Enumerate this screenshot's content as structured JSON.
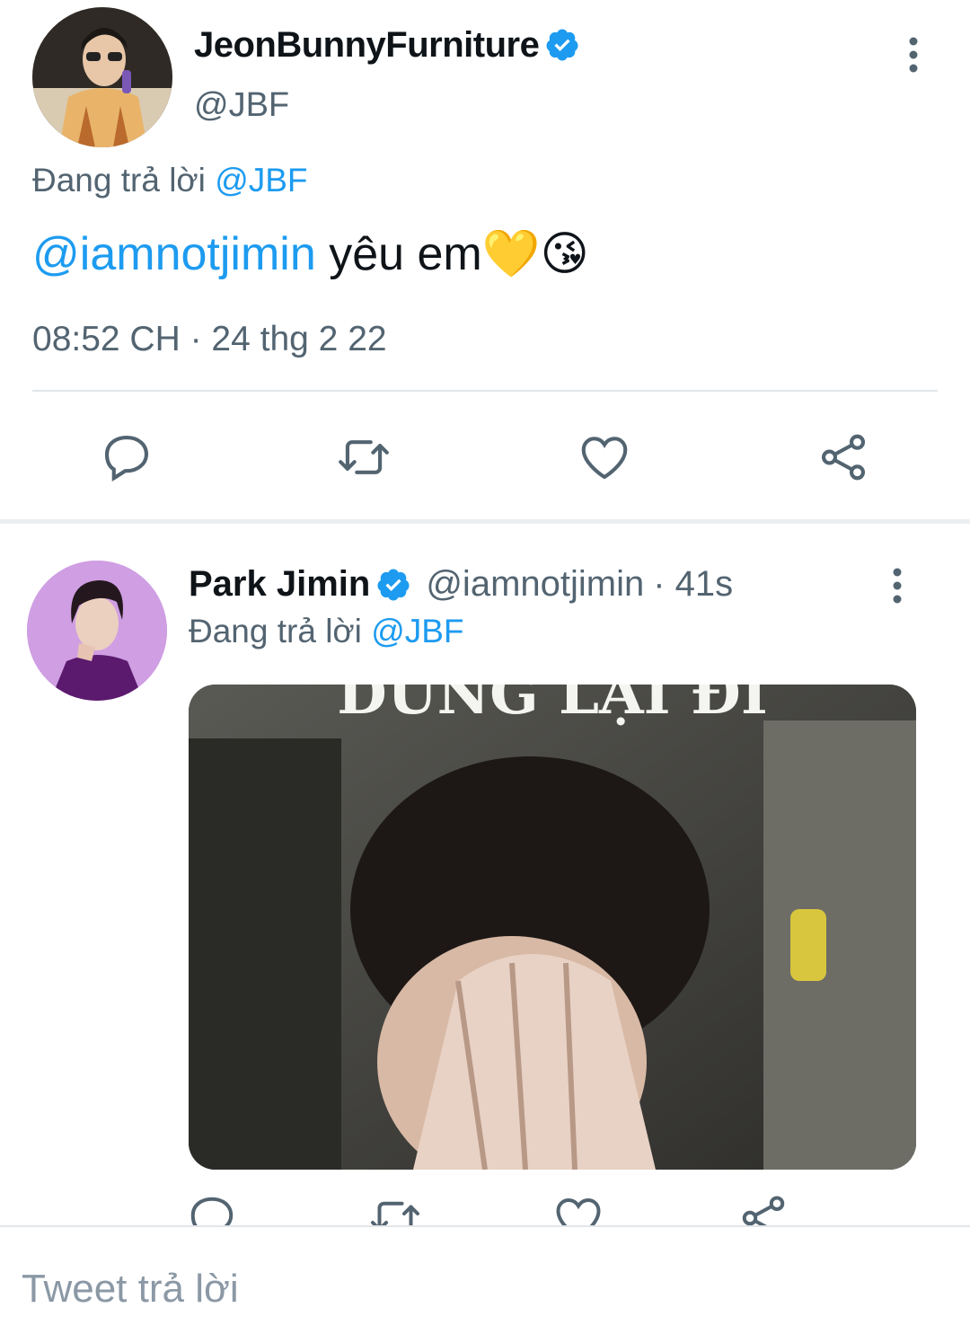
{
  "tweet1": {
    "display_name": "JeonBunnyFurniture",
    "handle": "@JBF",
    "replying_prefix": "Đang trả lời",
    "replying_to": "@JBF",
    "mention": "@iamnotjimin",
    "body_text": "yêu em",
    "emojis": "💛😘",
    "timestamp": "08:52 CH · 24 thg 2 22",
    "actions": [
      "reply-icon",
      "retweet-icon",
      "like-icon",
      "share-icon"
    ]
  },
  "tweet2": {
    "display_name": "Park Jimin",
    "handle": "@iamnotjimin",
    "time_ago": "· 41s",
    "replying_prefix": "Đang trả lời",
    "replying_to": "@JBF",
    "media_caption": "DỪNG LẠI ĐI"
  },
  "reply_box": {
    "placeholder": "Tweet trả lời"
  },
  "colors": {
    "accent": "#1d9bf0",
    "secondary_text": "#536471",
    "divider": "#e3e6e9"
  }
}
